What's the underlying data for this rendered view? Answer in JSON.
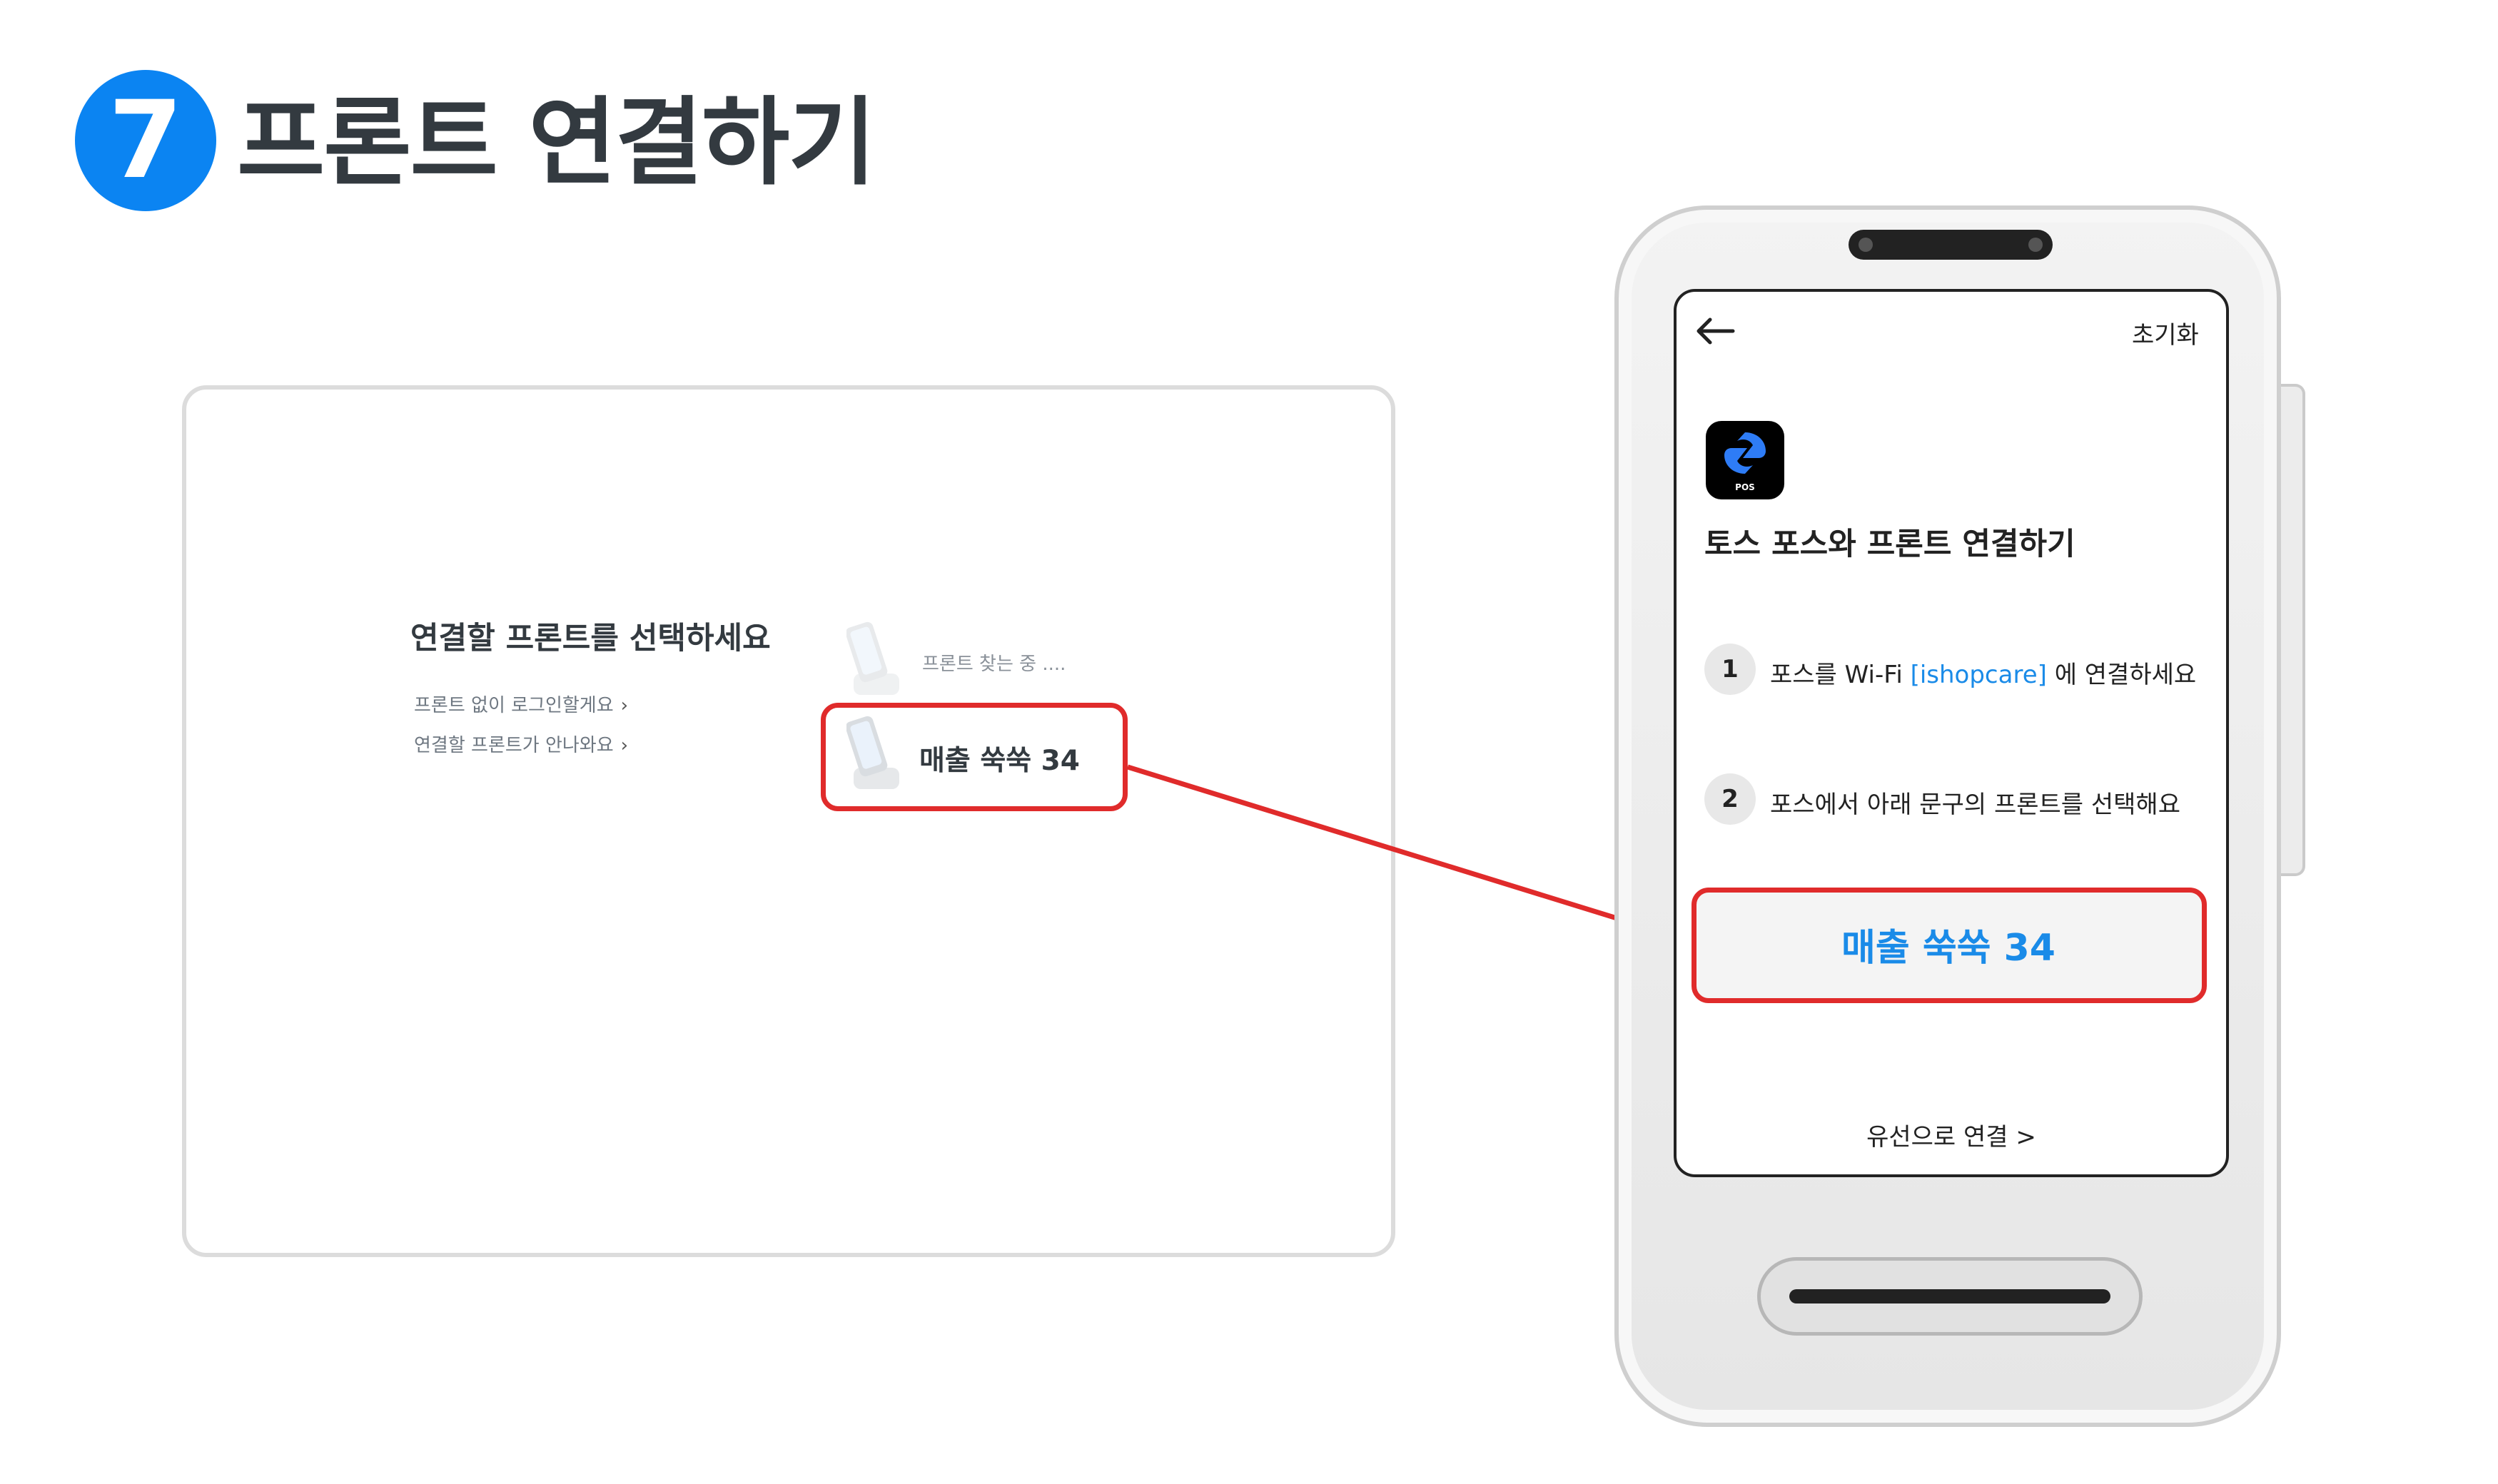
{
  "step": {
    "number": "7",
    "title": "프론트 연결하기",
    "badge_color": "#0b84f2"
  },
  "pos_screen": {
    "heading": "연결할 프론트를 선택하세요",
    "links": [
      "프론트 없이 로그인할게요",
      "연결할 프론트가 안나와요"
    ],
    "searching_text": "프론트 찾는 중 ....",
    "front_item": "매출 쑥쑥 34",
    "icons": {
      "chevron": "chevron-right-icon",
      "front_device": "front-device-icon"
    }
  },
  "front_device": {
    "back_icon": "arrow-left-icon",
    "reset_label": "초기화",
    "app_icon_label": "POS",
    "title": "토스 포스와 프론트 연결하기",
    "steps": [
      {
        "number": "1",
        "text_before": "포스를 Wi-Fi ",
        "ssid": "[ishopcare]",
        "text_after": " 에 연결하세요"
      },
      {
        "number": "2",
        "text": "포스에서 아래 문구의 프론트를 선택해요"
      }
    ],
    "code": "매출 쑥쑥 34",
    "wired_link": "유선으로 연결 >"
  },
  "colors": {
    "highlight": "#e02b2b",
    "accent": "#1a8be8"
  }
}
